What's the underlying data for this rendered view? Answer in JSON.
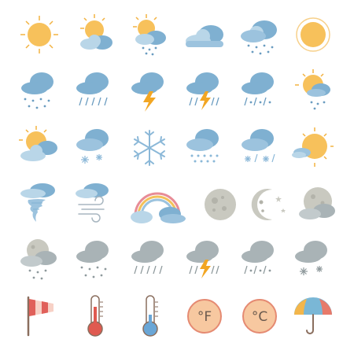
{
  "colors": {
    "sun": "#f7c15b",
    "sun_ray": "#f2b240",
    "cloud_blue": "#7fb0d1",
    "cloud_light": "#b9d6e8",
    "cloud_gray": "#a9b3b6",
    "cloud_gray_dark": "#8e999c",
    "rain": "#6a9cc0",
    "bolt": "#f2a623",
    "snow": "#8bb8d8",
    "moon": "#c9c9c0",
    "flag_red": "#e0605a",
    "temp_red": "#e05a50",
    "temp_blue": "#6aa6d6",
    "badge_fill": "#f7c8a0",
    "badge_ring": "#e58a72",
    "umbrella_left": "#f3b64b",
    "umbrella_mid": "#7ab7d6",
    "umbrella_right": "#e77a6a"
  },
  "icons": {
    "row1": [
      "sun-icon",
      "partly-cloudy-icon",
      "sun-rain-icon",
      "clouds-icon",
      "cloud-rain-icon",
      "sun-icon"
    ],
    "row2": [
      "rain-icon",
      "heavy-rain-icon",
      "thunderstorm-icon",
      "thunderstorm-rain-icon",
      "rain-hail-icon",
      "sun-shower-icon"
    ],
    "row3": [
      "partly-cloudy-icon",
      "cloud-snow-icon",
      "snowflake-icon",
      "cloud-hail-icon",
      "cloud-sleet-icon",
      "sun-cloud-icon"
    ],
    "row4": [
      "tornado-icon",
      "wind-icon",
      "rainbow-icon",
      "full-moon-icon",
      "crescent-moon-stars-icon",
      "moon-cloud-icon"
    ],
    "row5": [
      "moon-cloud-rain-icon",
      "cloud-drizzle-icon",
      "cloud-heavy-rain-icon",
      "storm-icon",
      "cloud-sleet-icon",
      "cloud-snow-icon"
    ],
    "row6": [
      "windsock-icon",
      "thermometer-hot-icon",
      "thermometer-cold-icon",
      "fahrenheit-icon",
      "celsius-icon",
      "umbrella-icon"
    ]
  },
  "units": {
    "fahrenheit": "°F",
    "celsius": "°C"
  }
}
